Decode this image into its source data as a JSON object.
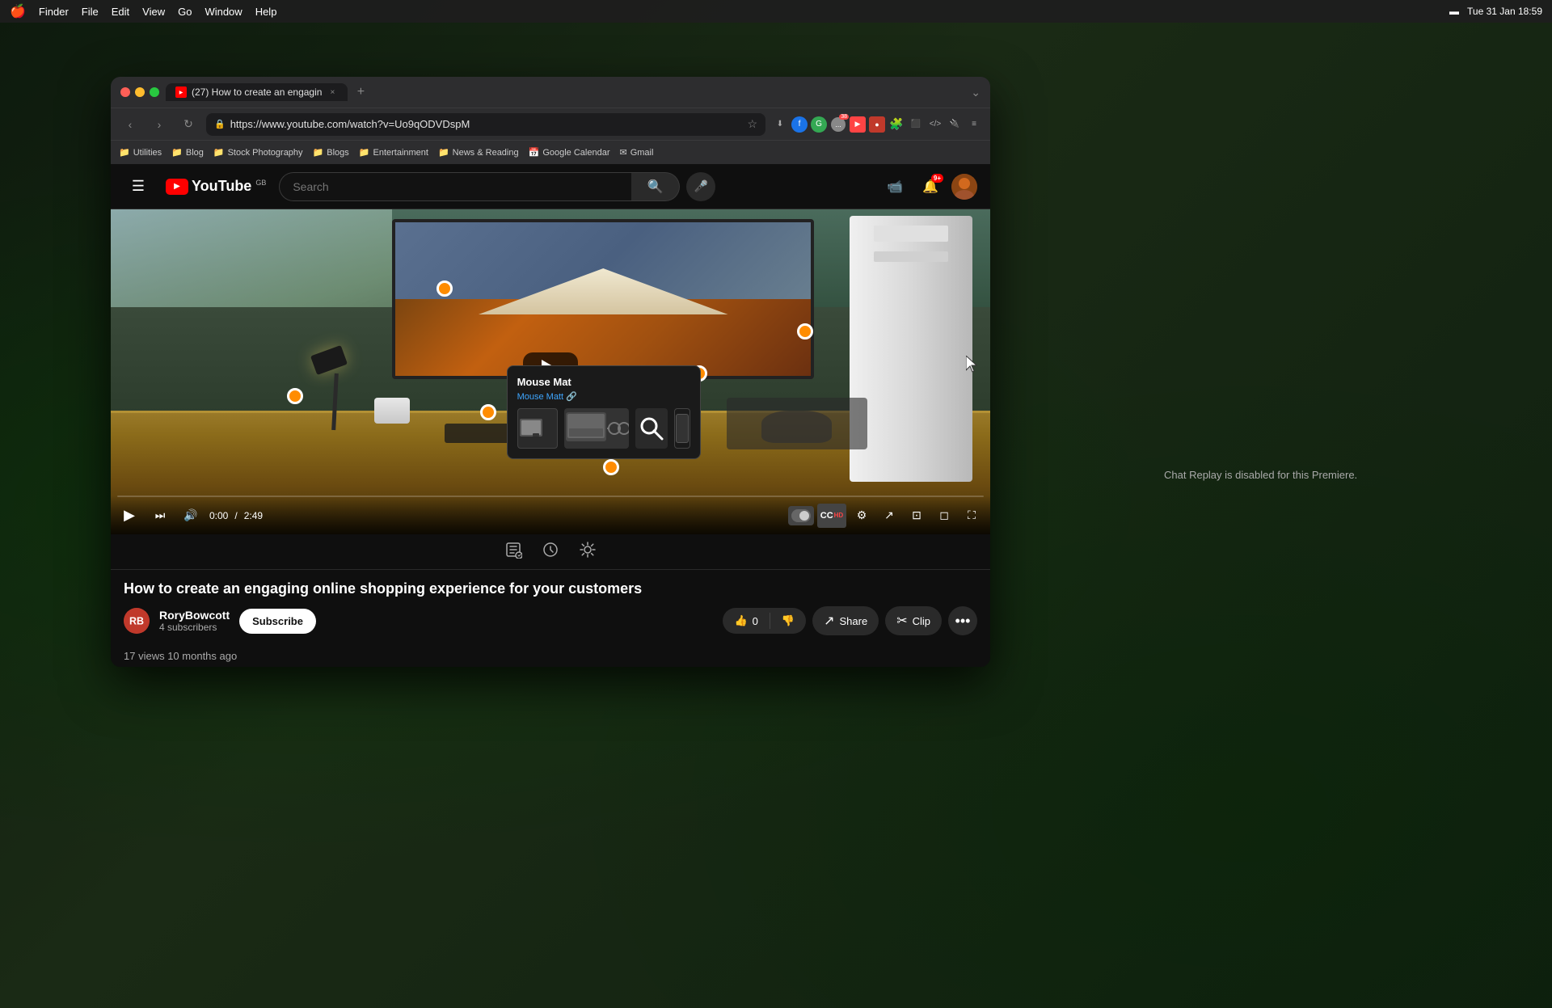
{
  "os": {
    "menubar": {
      "apple": "🍎",
      "items": [
        "Finder",
        "File",
        "Edit",
        "View",
        "Go",
        "Window",
        "Help"
      ],
      "right": {
        "time": "Tue 31 Jan  18:59"
      }
    }
  },
  "browser": {
    "tab": {
      "label": "(27) How to create an engagin",
      "close": "×",
      "new_tab": "+"
    },
    "nav": {
      "back": "‹",
      "forward": "›",
      "refresh": "↻",
      "url": "https://www.youtube.com/watch?v=Uo9qODVDspM",
      "bookmark": "☆"
    },
    "bookmarks": [
      {
        "label": "Utilities",
        "icon": "📁"
      },
      {
        "label": "Blog",
        "icon": "📁"
      },
      {
        "label": "Stock Photography",
        "icon": "📁"
      },
      {
        "label": "Blogs",
        "icon": "📁"
      },
      {
        "label": "Entertainment",
        "icon": "📁"
      },
      {
        "label": "News & Reading",
        "icon": "📁"
      },
      {
        "label": "Google Calendar",
        "icon": "📅"
      },
      {
        "label": "Gmail",
        "icon": "✉"
      }
    ]
  },
  "youtube": {
    "header": {
      "search_placeholder": "Search",
      "mic_label": "Search with voice",
      "create_label": "+",
      "notifications_label": "🔔",
      "notification_count": "9+",
      "logo_country": "GB"
    },
    "video": {
      "title": "How to create an engaging online shopping experience for your customers",
      "duration": "2:49",
      "current_time": "0:00",
      "progress": "0"
    },
    "channel": {
      "name": "RoryBowcott",
      "subscribers": "4 subscribers",
      "subscribe_btn": "Subscribe"
    },
    "actions": {
      "like_count": "0",
      "like_icon": "👍",
      "dislike_icon": "👎",
      "share_label": "Share",
      "share_icon": "↗",
      "clip_label": "Clip",
      "clip_icon": "✂",
      "more_icon": "•••"
    },
    "toolbar": {
      "icons": [
        "📋",
        "✏️",
        "⚙️"
      ]
    },
    "product_popup": {
      "title": "Mouse Mat",
      "link": "Mouse Matt 🔗"
    },
    "chat": {
      "disabled_text": "Chat Replay is disabled for this Premiere."
    },
    "stats": {
      "views": "17 views",
      "time_ago": "10 months ago"
    },
    "controls": {
      "play": "▶",
      "next": "⏭",
      "volume": "🔊",
      "time": "0:00 / 2:49",
      "settings": "⚙",
      "miniplayer": "⊡",
      "theater": "◻",
      "fullscreen": "⛶",
      "cc": "CC",
      "autoplay": "⚙"
    }
  }
}
